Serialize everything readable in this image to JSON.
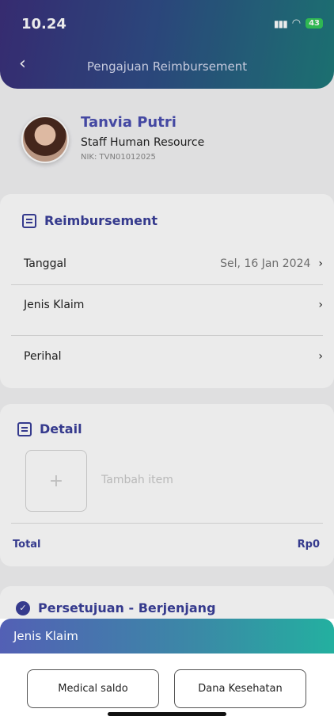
{
  "status_bar": {
    "time": "10.24",
    "battery": "43"
  },
  "header": {
    "title": "Pengajuan Reimbursement"
  },
  "profile": {
    "name": "Tanvia Putri",
    "role": "Staff Human Resource",
    "nik": "NIK: TVN01012025"
  },
  "reimbursement": {
    "title": "Reimbursement",
    "rows": [
      {
        "label": "Tanggal",
        "value": "Sel, 16 Jan 2024"
      },
      {
        "label": "Jenis Klaim",
        "value": ""
      },
      {
        "label": "Perihal",
        "value": ""
      }
    ]
  },
  "detail": {
    "title": "Detail",
    "add_label": "Tambah item",
    "total_label": "Total",
    "total_value": "Rp0"
  },
  "approval": {
    "title": "Persetujuan - Berjenjang"
  },
  "sheet": {
    "title": "Jenis Klaim",
    "options": [
      "Medical saldo",
      "Dana Kesehatan"
    ]
  }
}
